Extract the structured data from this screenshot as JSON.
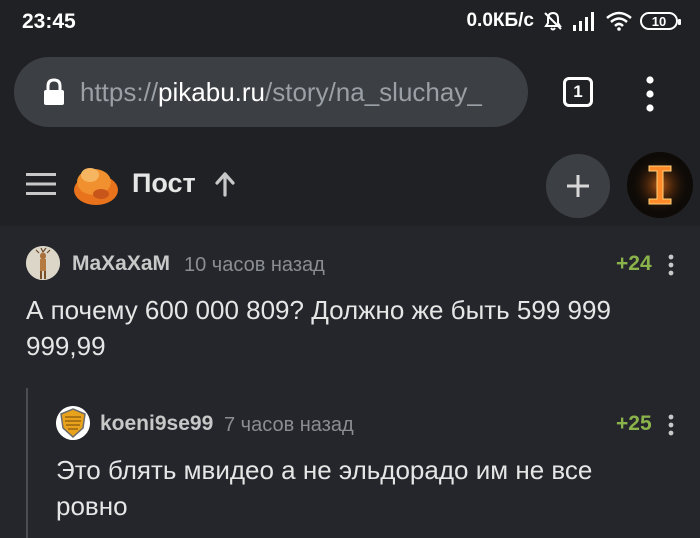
{
  "status": {
    "time": "23:45",
    "network_speed": "0.0КБ/с",
    "battery": "10",
    "icons": [
      "mute-bell-icon",
      "signal-icon",
      "wifi-icon",
      "battery-icon"
    ]
  },
  "browser": {
    "url_prefix": "https://",
    "url_domain": "pikabu.ru",
    "url_path": "/story/na_sluchay_",
    "tab_count": "1"
  },
  "header": {
    "title": "Пост"
  },
  "comments": [
    {
      "author": "MaXaXaM",
      "time": "10 часов назад",
      "rating": "+24",
      "text": "А почему 600 000 809? Должно же быть 599 999 999,99"
    },
    {
      "author": "koeni9se99",
      "time": "7 часов назад",
      "rating": "+25",
      "text": "Это блять мвидео а не эльдорадо им не все ровно"
    }
  ],
  "colors": {
    "background": "#24262b",
    "bar": "#202124",
    "rating": "#8bb34b",
    "text": "#e6e6e6"
  }
}
